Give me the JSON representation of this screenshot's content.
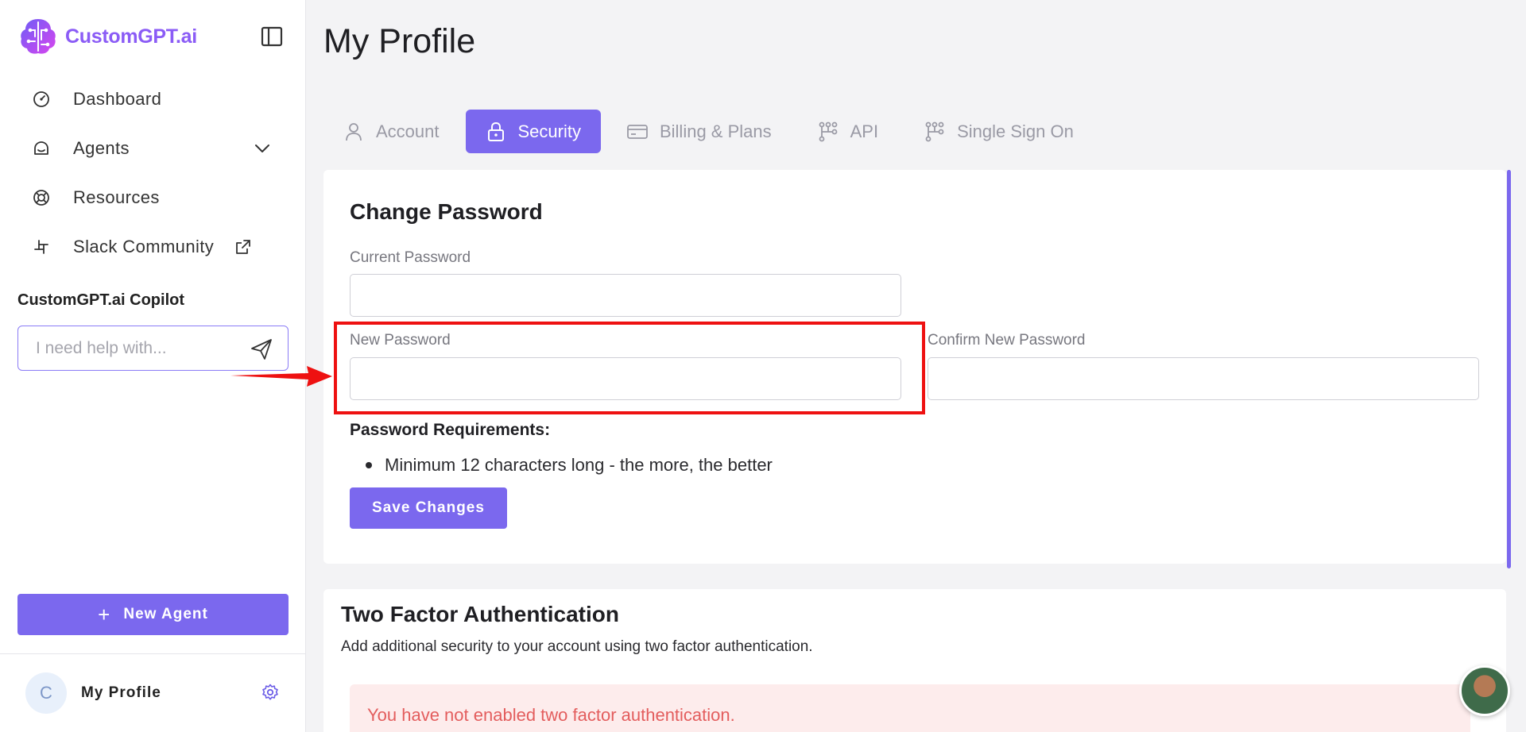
{
  "brand": {
    "name": "CustomGPT.ai"
  },
  "sidebar": {
    "nav": [
      {
        "label": "Dashboard",
        "icon": "dashboard-icon"
      },
      {
        "label": "Agents",
        "icon": "agents-icon"
      },
      {
        "label": "Resources",
        "icon": "lifebuoy-icon"
      },
      {
        "label": "Slack Community",
        "icon": "slack-icon"
      }
    ],
    "copilot": {
      "title": "CustomGPT.ai Copilot",
      "placeholder": "I need help with..."
    },
    "new_agent_label": "New Agent",
    "profile": {
      "initial": "C",
      "name": "My Profile"
    }
  },
  "page": {
    "title": "My Profile"
  },
  "tabs": [
    {
      "label": "Account",
      "active": false
    },
    {
      "label": "Security",
      "active": true
    },
    {
      "label": "Billing & Plans",
      "active": false
    },
    {
      "label": "API",
      "active": false
    },
    {
      "label": "Single Sign On",
      "active": false
    }
  ],
  "change_password": {
    "title": "Change Password",
    "current_label": "Current Password",
    "current_value": "",
    "new_label": "New Password",
    "new_value": "",
    "confirm_label": "Confirm New Password",
    "confirm_value": "",
    "requirements_title": "Password Requirements:",
    "requirements": [
      "Minimum 12 characters long - the more, the better"
    ],
    "save_label": "Save Changes"
  },
  "two_factor": {
    "title": "Two Factor Authentication",
    "description": "Add additional security to your account using two factor authentication.",
    "alert": "You have not enabled two factor authentication."
  },
  "colors": {
    "accent": "#7b68ee",
    "brand_gradient": [
      "#6d5cf6",
      "#d946ef"
    ],
    "highlight_red": "#ee1111",
    "alert_bg": "#fdecec",
    "alert_text": "#e35d5d"
  }
}
